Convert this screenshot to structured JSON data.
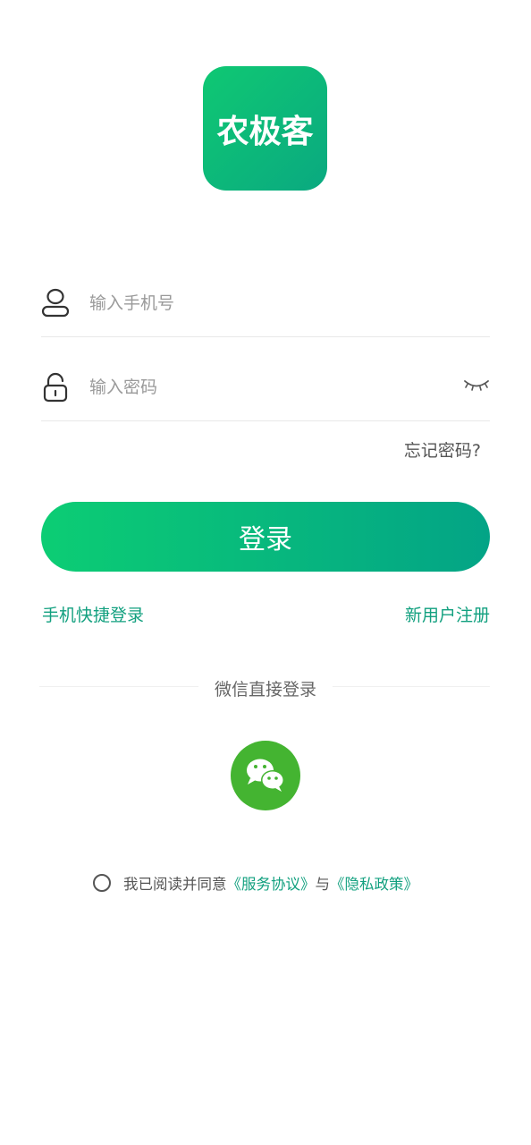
{
  "logo": {
    "text": "农极客"
  },
  "phone_field": {
    "placeholder": "输入手机号",
    "value": ""
  },
  "password_field": {
    "placeholder": "输入密码",
    "value": ""
  },
  "forgot_password": "忘记密码?",
  "login_button": "登录",
  "quick_login": "手机快捷登录",
  "register": "新用户注册",
  "wechat_login": "微信直接登录",
  "agreement": {
    "prefix": "我已阅读并同意",
    "service_link": "《服务协议》",
    "conjunction": "与",
    "privacy_link": "《隐私政策》",
    "checked": false
  },
  "icons": {
    "user": "user-icon",
    "lock": "lock-icon",
    "eye": "eye-closed-icon",
    "wechat": "wechat-icon",
    "radio": "radio-unchecked-icon"
  },
  "colors": {
    "brand_green": "#0aa980",
    "button_gradient_start": "#0ccd74",
    "button_gradient_end": "#03a486",
    "link_green": "#12a07f",
    "wechat_green": "#44b431"
  }
}
